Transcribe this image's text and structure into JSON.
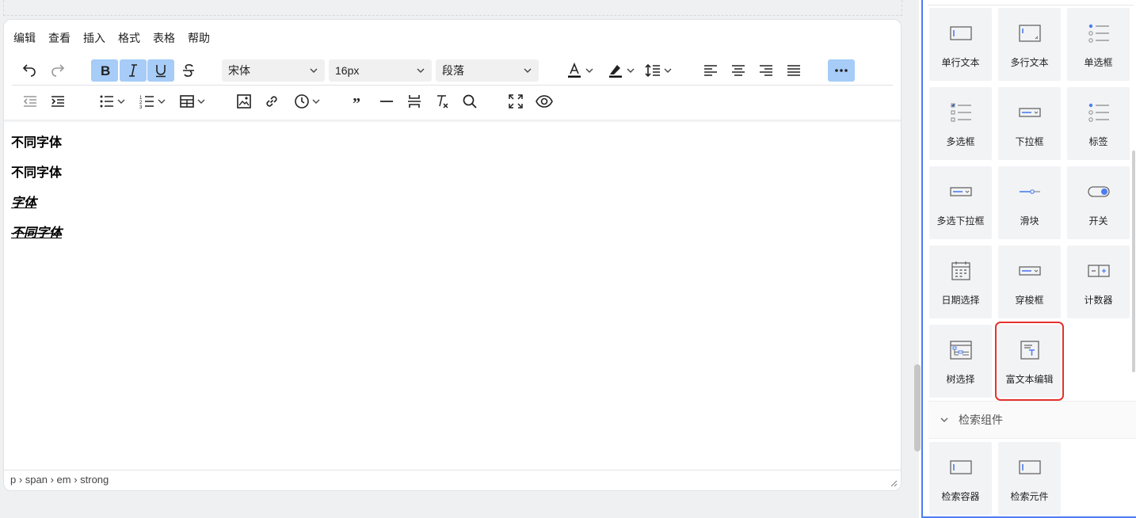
{
  "menubar": [
    "编辑",
    "查看",
    "插入",
    "格式",
    "表格",
    "帮助"
  ],
  "toolbar": {
    "font_family": "宋体",
    "font_size": "16px",
    "block_format": "段落",
    "active_color": "#a6ccf7"
  },
  "content": {
    "lines": [
      "不同字体",
      "不同字体",
      "字体",
      "不同字体"
    ]
  },
  "statusbar": {
    "path": "p › span › em › strong"
  },
  "widgets": [
    {
      "label": "单行文本",
      "icon": "text-input-icon"
    },
    {
      "label": "多行文本",
      "icon": "textarea-icon"
    },
    {
      "label": "单选框",
      "icon": "radio-icon"
    },
    {
      "label": "多选框",
      "icon": "checkbox-icon"
    },
    {
      "label": "下拉框",
      "icon": "select-icon"
    },
    {
      "label": "标签",
      "icon": "tag-icon"
    },
    {
      "label": "多选下拉框",
      "icon": "multi-select-icon"
    },
    {
      "label": "滑块",
      "icon": "slider-icon"
    },
    {
      "label": "开关",
      "icon": "switch-icon"
    },
    {
      "label": "日期选择",
      "icon": "calendar-icon"
    },
    {
      "label": "穿梭框",
      "icon": "transfer-icon"
    },
    {
      "label": "计数器",
      "icon": "counter-icon"
    },
    {
      "label": "树选择",
      "icon": "tree-icon"
    },
    {
      "label": "富文本编辑",
      "icon": "rich-text-icon"
    }
  ],
  "section": {
    "label": "检索组件"
  },
  "search_widgets": [
    {
      "label": "检索容器",
      "icon": "search-container-icon"
    },
    {
      "label": "检索元件",
      "icon": "search-element-icon"
    }
  ],
  "colors": {
    "panel_border": "#4d7cf1",
    "highlight_outline": "#e5322d",
    "widget_bg": "#f2f3f5",
    "icon_blue": "#4d7cf1"
  }
}
